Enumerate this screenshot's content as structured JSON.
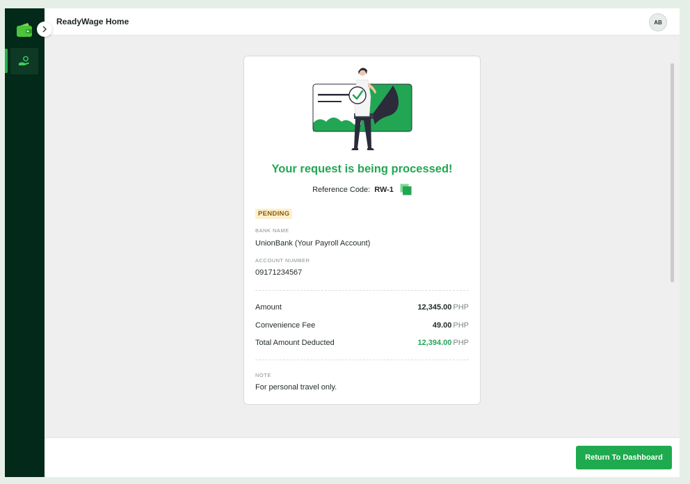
{
  "header": {
    "title": "ReadyWage Home",
    "avatar_initials": "AB"
  },
  "confirmation": {
    "headline": "Your request is being processed!",
    "reference_label": "Reference Code:",
    "reference_code": "RW-1",
    "status": "PENDING",
    "bank_name_label": "BANK NAME",
    "bank_name": "UnionBank (Your Payroll Account)",
    "account_number_label": "ACCOUNT NUMBER",
    "account_number": "09171234567",
    "breakdown": [
      {
        "label": "Amount",
        "value": "12,345.00",
        "unit": "PHP"
      },
      {
        "label": "Convenience Fee",
        "value": "49.00",
        "unit": "PHP"
      },
      {
        "label": "Total Amount Deducted",
        "value": "12,394.00",
        "unit": "PHP"
      }
    ],
    "note_label": "NOTE",
    "note": "For personal travel only."
  },
  "footer": {
    "button_label": "Return To Dashboard"
  },
  "icons": {
    "logo": "wallet-icon",
    "nav": "cash-hand-icon",
    "collapse": "chevron-right-icon",
    "copy": "copy-icon"
  },
  "colors": {
    "brand_green": "#22a653",
    "sidebar": "#03291a",
    "pending_bg": "#fdf0cf"
  }
}
